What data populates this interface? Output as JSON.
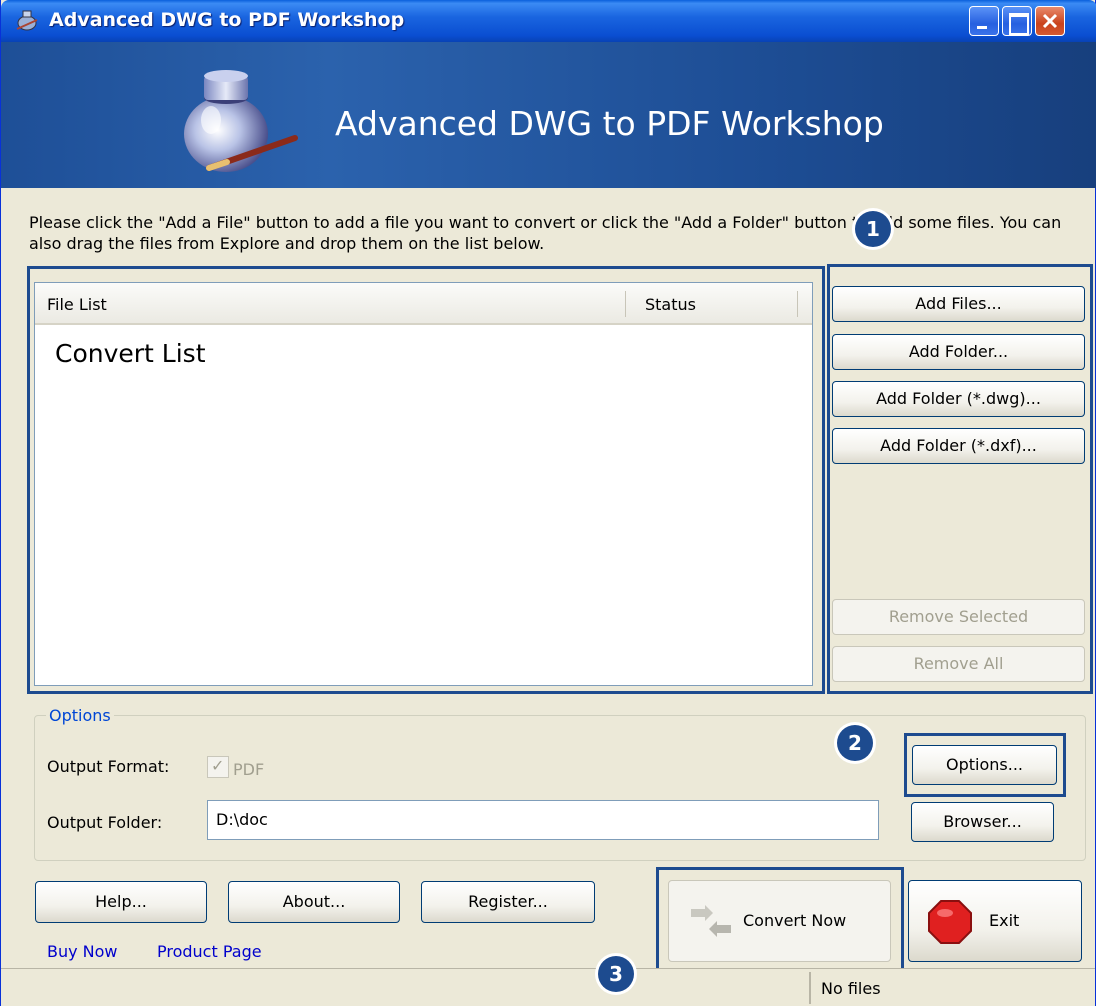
{
  "window": {
    "title": "Advanced DWG to PDF Workshop"
  },
  "banner": {
    "title": "Advanced DWG to PDF Workshop"
  },
  "instructions": "Please click the \"Add a File\" button to add a file you want to convert or click the \"Add a Folder\" button to add some files. You can also drag the files from Explore and drop them on the list below.",
  "file_list": {
    "columns": [
      "File List",
      "Status"
    ],
    "overlay_label": "Convert List"
  },
  "side_buttons": {
    "add_files": "Add Files...",
    "add_folder": "Add Folder...",
    "add_folder_dwg": "Add Folder (*.dwg)...",
    "add_folder_dxf": "Add Folder (*.dxf)...",
    "remove_selected": "Remove Selected",
    "remove_all": "Remove All"
  },
  "options": {
    "legend": "Options",
    "output_format_label": "Output Format:",
    "output_format_value": "PDF",
    "output_format_checked": true,
    "output_folder_label": "Output Folder:",
    "output_folder_value": "D:\\doc",
    "options_button": "Options...",
    "browser_button": "Browser..."
  },
  "bottom_buttons": {
    "help": "Help...",
    "about": "About...",
    "register": "Register...",
    "convert_now": "Convert Now",
    "exit": "Exit"
  },
  "links": {
    "buy_now": "Buy Now",
    "product_page": "Product Page"
  },
  "badges": {
    "step1": "1",
    "step2": "2",
    "step3": "3"
  },
  "status": {
    "text": "No files"
  },
  "colors": {
    "titlebar": "#0a4ed1",
    "banner": "#1e4f97",
    "highlight_frame": "#1d4b8f",
    "link": "#0000cc",
    "exit_icon": "#e02020"
  }
}
